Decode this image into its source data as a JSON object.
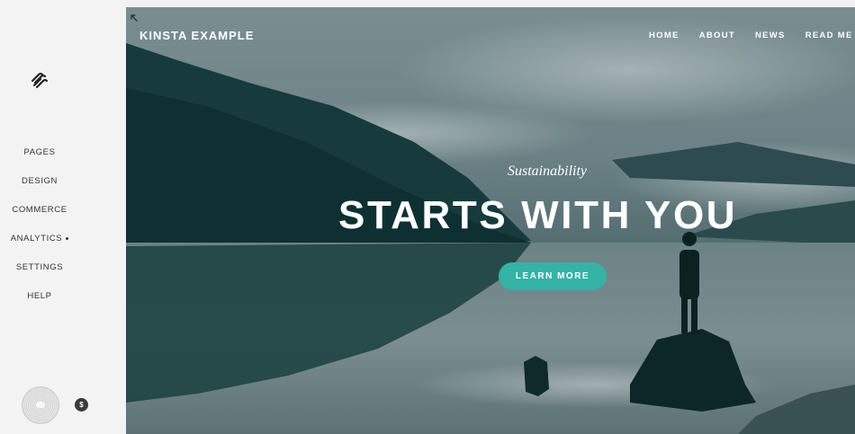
{
  "sidebar": {
    "logo_icon": "squarespace-logo-icon",
    "items": [
      {
        "label": "PAGES"
      },
      {
        "label": "DESIGN"
      },
      {
        "label": "COMMERCE"
      },
      {
        "label": "ANALYTICS",
        "has_dot": true
      },
      {
        "label": "SETTINGS"
      },
      {
        "label": "HELP"
      }
    ],
    "badge": "$"
  },
  "site": {
    "title": "KINSTA EXAMPLE",
    "nav": [
      {
        "label": "HOME"
      },
      {
        "label": "ABOUT"
      },
      {
        "label": "NEWS"
      },
      {
        "label": "READ ME"
      }
    ]
  },
  "hero": {
    "subheading": "Sustainability",
    "headline": "STARTS WITH YOU",
    "cta_label": "LEARN MORE"
  },
  "colors": {
    "accent": "#34b3a6",
    "sidebar_bg": "#f3f3f3",
    "hero_tint": "#4f6a6f"
  }
}
